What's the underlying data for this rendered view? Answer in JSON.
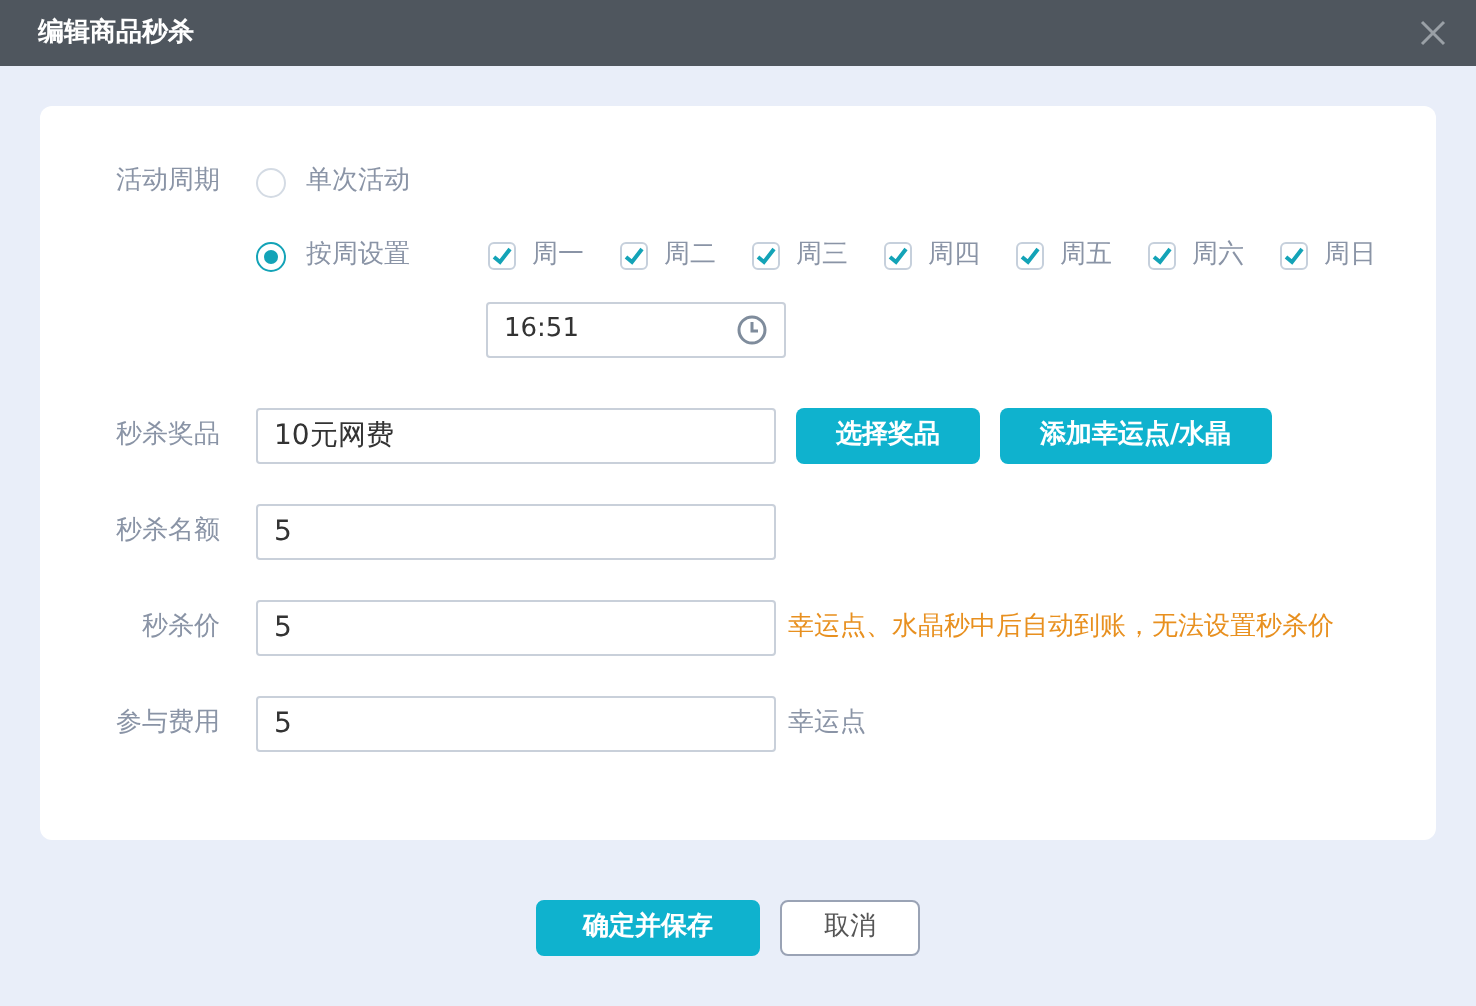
{
  "window": {
    "title": "编辑商品秒杀"
  },
  "period": {
    "label": "活动周期",
    "options": [
      {
        "label": "单次活动",
        "selected": false
      },
      {
        "label": "按周设置",
        "selected": true
      }
    ],
    "weekdays": [
      {
        "label": "周一",
        "checked": true
      },
      {
        "label": "周二",
        "checked": true
      },
      {
        "label": "周三",
        "checked": true
      },
      {
        "label": "周四",
        "checked": true
      },
      {
        "label": "周五",
        "checked": true
      },
      {
        "label": "周六",
        "checked": true
      },
      {
        "label": "周日",
        "checked": true
      }
    ],
    "time": {
      "value": "16:51"
    }
  },
  "fields": [
    {
      "label": "秒杀奖品",
      "value": "10元网费",
      "buttons": [
        "选择奖品",
        "添加幸运点/水晶"
      ]
    },
    {
      "label": "秒杀名额",
      "value": "5"
    },
    {
      "label": "秒杀价",
      "value": "5",
      "note": {
        "kind": "warning",
        "text": "幸运点、水晶秒中后自动到账，无法设置秒杀价"
      }
    },
    {
      "label": "参与费用",
      "value": "5",
      "note": {
        "kind": "unit",
        "text": "幸运点"
      }
    }
  ],
  "footer": {
    "buttons": [
      {
        "label": "确定并保存",
        "kind": "primary"
      },
      {
        "label": "取消",
        "kind": "secondary"
      }
    ]
  }
}
